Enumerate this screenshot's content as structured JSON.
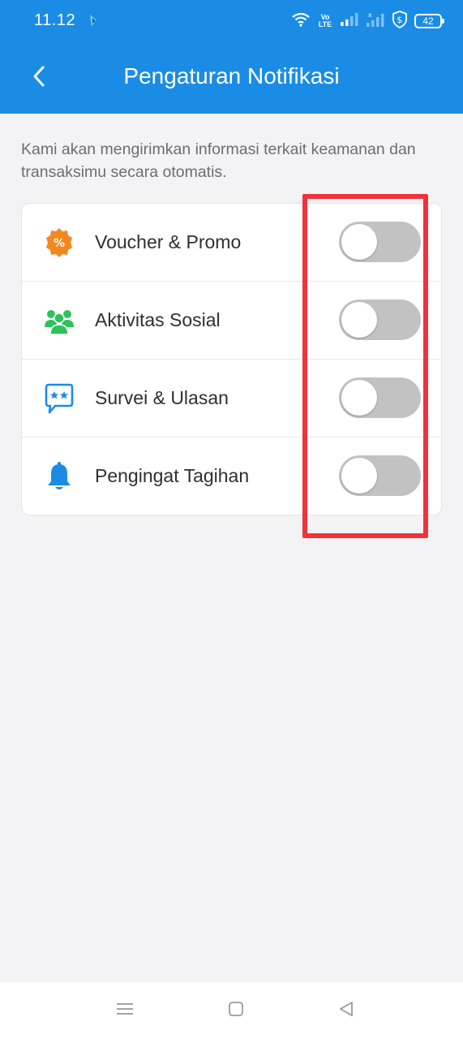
{
  "status_bar": {
    "time": "11.12",
    "volte_top": "Vo",
    "volte_bottom": "LTE",
    "battery": "42"
  },
  "app_bar": {
    "title": "Pengaturan Notifikasi",
    "background_color": "#1a8ce6"
  },
  "description": "Kami akan mengirimkan informasi terkait keamanan dan transaksimu secara otomatis.",
  "settings": [
    {
      "label": "Voucher & Promo",
      "icon": "discount-badge-icon",
      "icon_color": "#f5871f",
      "enabled": false
    },
    {
      "label": "Aktivitas Sosial",
      "icon": "people-group-icon",
      "icon_color": "#2ec25b",
      "enabled": false
    },
    {
      "label": "Survei & Ulasan",
      "icon": "rating-chat-icon",
      "icon_color": "#1a8ce6",
      "enabled": false
    },
    {
      "label": "Pengingat Tagihan",
      "icon": "bell-icon",
      "icon_color": "#1a8ce6",
      "enabled": false
    }
  ],
  "highlight_color": "#f0323b",
  "nav_bar": {
    "buttons": [
      "menu-icon",
      "home-icon",
      "back-triangle-icon"
    ]
  }
}
